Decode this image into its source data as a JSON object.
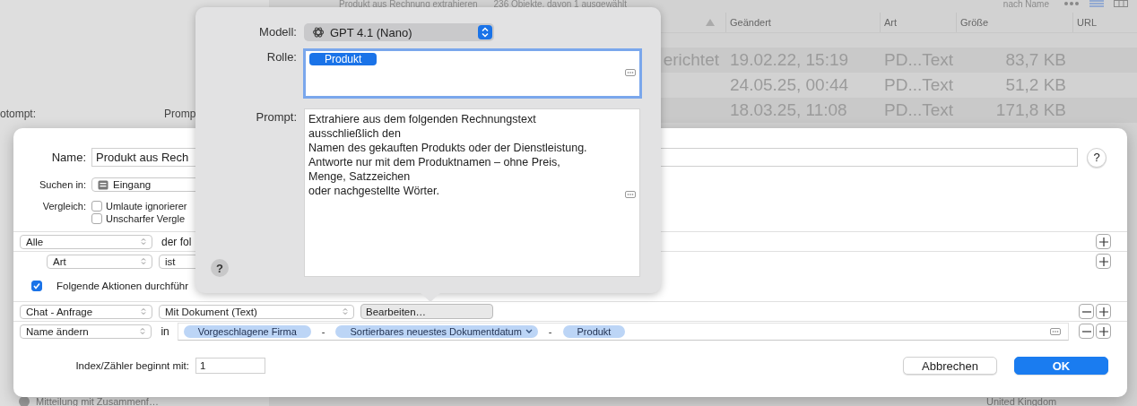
{
  "background": {
    "toolbar": {
      "title": "Produkt aus Rechnung extrahieren",
      "status": "236 Objekte, davon 1 ausgewählt",
      "sort": "nach Name"
    },
    "side_labels": [
      "otompt:",
      "Promp"
    ],
    "table": {
      "columns": [
        "Geändert",
        "Art",
        "Größe",
        "URL"
      ],
      "rows": [
        {
          "name": "erichtet",
          "modified": "19.02.22, 15:19",
          "file_kind": "PD...Text",
          "size": "83,7 KB"
        },
        {
          "modified": "24.05.25, 00:44",
          "file_kind": "PD...Text",
          "size": "51,2 KB"
        },
        {
          "modified": "18.03.25, 11:08",
          "file_kind": "PD...Text",
          "size": "171,8 KB"
        }
      ]
    },
    "footer": {
      "item": "Mitteilung mit Zusammenf…",
      "location": "United Kingdom"
    }
  },
  "sheet": {
    "name": {
      "label": "Name:",
      "value": "Produkt aus Rech"
    },
    "help": "?",
    "search": {
      "label": "Suchen in:",
      "value": "Eingang"
    },
    "compare": {
      "label": "Vergleich:",
      "options": [
        {
          "label": "Umlaute ignorierer",
          "checked": false
        },
        {
          "label": "Unscharfer Vergle",
          "checked": false
        }
      ]
    },
    "condition": {
      "match": "Alle",
      "text": "der fol",
      "children": [
        {
          "field": "Art",
          "operator": "ist"
        }
      ]
    },
    "perform": {
      "label": "Folgende Aktionen durchführ",
      "checked": true
    },
    "actions": [
      {
        "kind": "chat",
        "action": "Chat - Anfrage",
        "mode": "Mit Dokument (Text)",
        "button": "Bearbeiten…"
      },
      {
        "kind": "rename",
        "action": "Name ändern",
        "in": "in",
        "parts": [
          {
            "kind": "token",
            "label": "Vorgeschlagene Firma",
            "menu": false
          },
          {
            "kind": "separator",
            "label": "-"
          },
          {
            "kind": "token",
            "label": "Sortierbares neuestes Dokumentdatum",
            "menu": true
          },
          {
            "kind": "separator",
            "label": "-"
          },
          {
            "kind": "token",
            "label": "Produkt",
            "menu": false
          }
        ]
      }
    ],
    "index": {
      "label": "Index/Zähler beginnt mit:",
      "value": "1"
    },
    "buttons": [
      {
        "label": "Abbrechen",
        "default": false
      },
      {
        "label": "OK",
        "default": true
      }
    ]
  },
  "popover": {
    "model": {
      "label": "Modell:",
      "value": "GPT 4.1 (Nano)"
    },
    "role": {
      "label": "Rolle:",
      "tokens": [
        "Produkt"
      ]
    },
    "prompt": {
      "label": "Prompt:",
      "value": "Extrahiere aus dem folgenden Rechnungstext\nausschließlich den\nNamen des gekauften Produkts oder der Dienstleistung.\nAntworte nur mit dem Produktnamen – ohne Preis,\nMenge, Satzzeichen\noder nachgestellte Wörter."
    },
    "help": "?"
  }
}
